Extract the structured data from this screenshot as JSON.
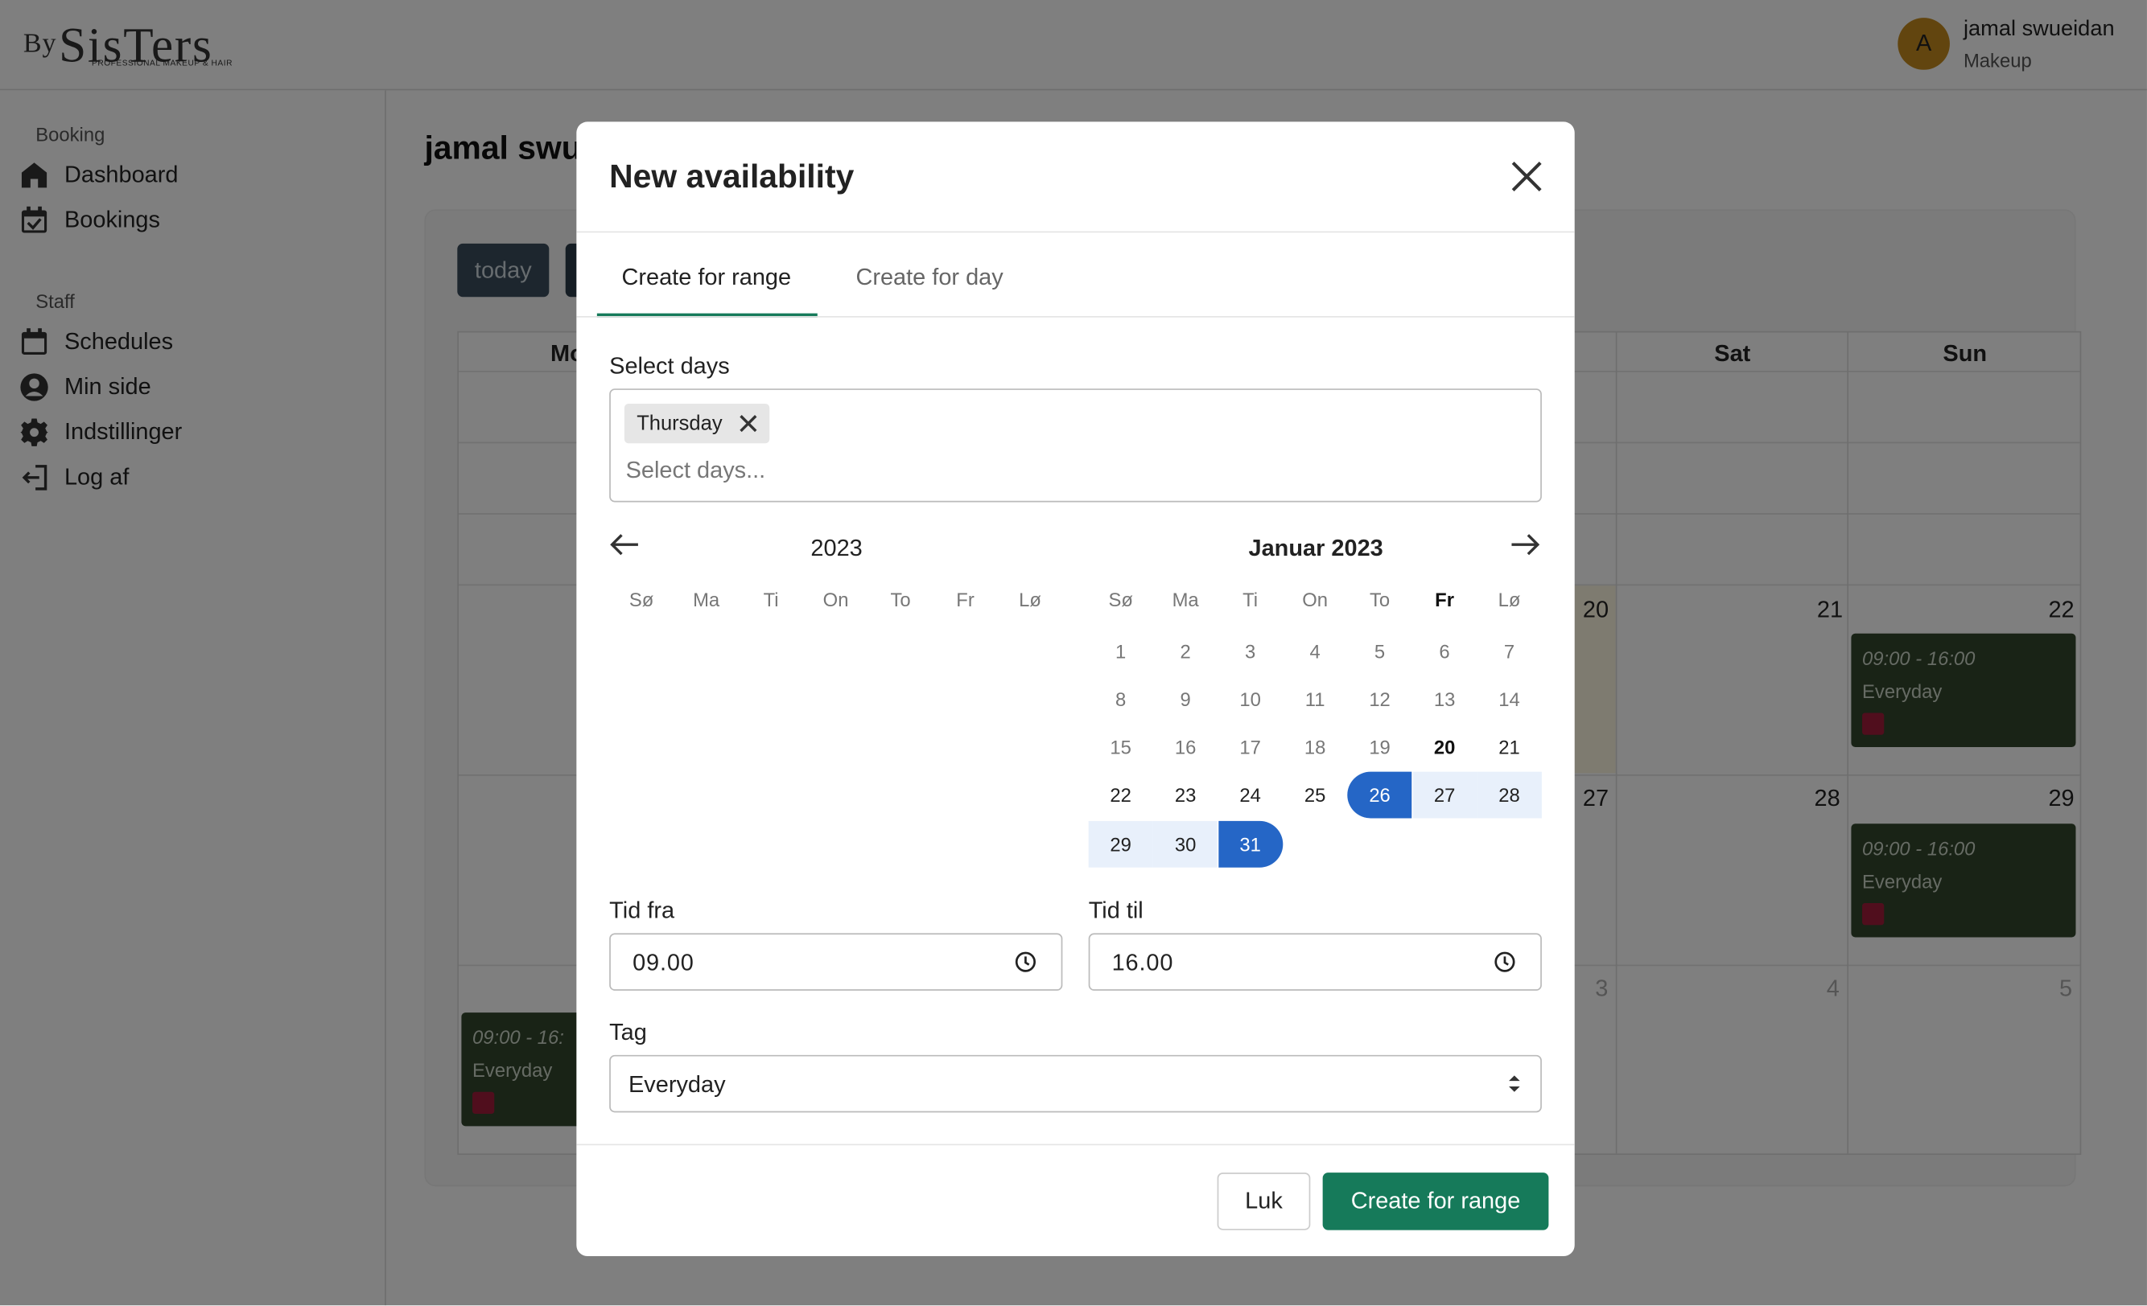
{
  "brand": {
    "by": "By",
    "name": "SisTers",
    "tagline": "PROFESSIONAL MAKEUP & HAIR"
  },
  "user": {
    "initial": "A",
    "name": "jamal swueidan",
    "role": "Makeup"
  },
  "sidebar": {
    "booking_label": "Booking",
    "booking_items": [
      {
        "label": "Dashboard",
        "icon": "home-icon"
      },
      {
        "label": "Bookings",
        "icon": "calendar-check-icon"
      }
    ],
    "staff_label": "Staff",
    "staff_items": [
      {
        "label": "Schedules",
        "icon": "calendar-icon"
      },
      {
        "label": "Min side",
        "icon": "user-circle-icon"
      },
      {
        "label": "Indstillinger",
        "icon": "gear-icon"
      },
      {
        "label": "Log af",
        "icon": "logout-icon"
      }
    ]
  },
  "main": {
    "title": "jamal swueidan",
    "today_label": "today",
    "weekday_headers": [
      "Mo",
      "Sat",
      "Sun"
    ],
    "day_numbers": {
      "row3": [
        "20",
        "21",
        "22"
      ],
      "row4": [
        "27",
        "28",
        "29"
      ],
      "row5": [
        "3",
        "4",
        "5"
      ]
    },
    "events": [
      {
        "time": "09:00 - 16:00",
        "tag": "Everyday"
      },
      {
        "time": "09:00 - 16:00",
        "tag": "Everyday"
      },
      {
        "time": "09:00 - 16:",
        "tag": "Everyday"
      }
    ]
  },
  "modal": {
    "title": "New availability",
    "tabs": [
      {
        "label": "Create for range",
        "active": true
      },
      {
        "label": "Create for day",
        "active": false
      }
    ],
    "select_days_label": "Select days",
    "selected_days": [
      "Thursday"
    ],
    "select_days_placeholder": "Select days...",
    "datepicker": {
      "left_title": "2023",
      "right_title": "Januar 2023",
      "weekdays": [
        "Sø",
        "Ma",
        "Ti",
        "On",
        "To",
        "Fr",
        "Lø"
      ],
      "right_weeks": [
        [
          "1",
          "2",
          "3",
          "4",
          "5",
          "6",
          "7"
        ],
        [
          "8",
          "9",
          "10",
          "11",
          "12",
          "13",
          "14"
        ],
        [
          "15",
          "16",
          "17",
          "18",
          "19",
          "20",
          "21"
        ],
        [
          "22",
          "23",
          "24",
          "25",
          "26",
          "27",
          "28"
        ],
        [
          "29",
          "30",
          "31"
        ]
      ],
      "today": "20",
      "range_start": "26",
      "range_end": "31"
    },
    "time_from_label": "Tid fra",
    "time_from_value": "09.00",
    "time_to_label": "Tid til",
    "time_to_value": "16.00",
    "tag_label": "Tag",
    "tag_value": "Everyday",
    "close_button": "Luk",
    "submit_button": "Create for range"
  },
  "colors": {
    "primary": "#167a5a",
    "selection": "#2566c6",
    "event_bg": "#33472d",
    "event_tag": "#a11d3a"
  }
}
